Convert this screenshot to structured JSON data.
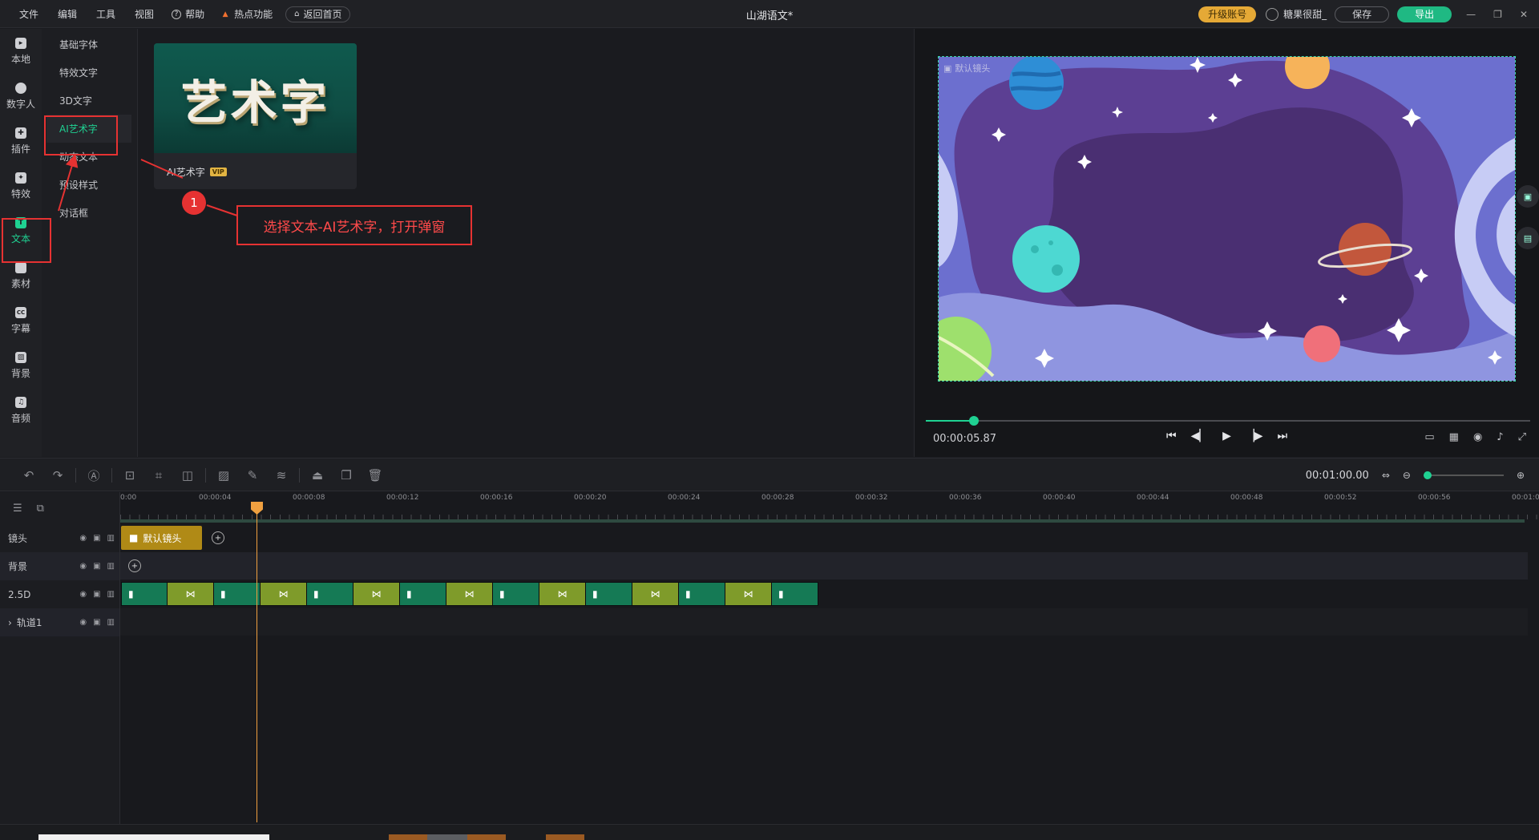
{
  "menu": {
    "file": "文件",
    "edit": "编辑",
    "tools": "工具",
    "view": "视图",
    "help": "帮助",
    "hot": "热点功能",
    "home": "返回首页"
  },
  "window_title": "山湖语文*",
  "account": {
    "upgrade": "升级账号",
    "username": "糖果很甜_",
    "save": "保存",
    "export": "导出"
  },
  "rail": [
    {
      "label": "本地",
      "icon": "folder-icon"
    },
    {
      "label": "数字人",
      "icon": "person-icon"
    },
    {
      "label": "插件",
      "icon": "plugin-icon"
    },
    {
      "label": "特效",
      "icon": "sparkle-icon"
    },
    {
      "label": "文本",
      "icon": "text-icon",
      "active": true
    },
    {
      "label": "素材",
      "icon": "material-icon"
    },
    {
      "label": "字幕",
      "icon": "subtitle-icon"
    },
    {
      "label": "背景",
      "icon": "background-icon"
    },
    {
      "label": "音频",
      "icon": "music-icon"
    }
  ],
  "submenu": [
    "基础字体",
    "特效文字",
    "3D文字",
    "AI艺术字",
    "动态文本",
    "预设样式",
    "对话框"
  ],
  "card": {
    "thumb_text": "艺术字",
    "label": "AI艺术字",
    "badge": "VIP"
  },
  "annotation": {
    "number": "1",
    "note": "选择文本-AI艺术字，打开弹窗"
  },
  "preview": {
    "camera_label": "默认镜头",
    "current_time": "00:00:05.87",
    "progress": 0.08
  },
  "toolbar": {
    "total_time": "00:01:00.00"
  },
  "ruler": [
    "0:00",
    "00:00:04",
    "00:00:08",
    "00:00:12",
    "00:00:16",
    "00:00:20",
    "00:00:24",
    "00:00:28",
    "00:00:32",
    "00:00:36",
    "00:00:40",
    "00:00:44",
    "00:00:48",
    "00:00:52",
    "00:00:56",
    "00:01:0"
  ],
  "tracks": [
    {
      "name": "镜头"
    },
    {
      "name": "背景"
    },
    {
      "name": "2.5D"
    },
    {
      "name": "轨道1"
    }
  ],
  "camera_clip": "默认镜头",
  "colors": {
    "accent": "#1fd192",
    "upgrade": "#e5a936",
    "annotation": "#e63232",
    "playhead": "#f0a040"
  }
}
